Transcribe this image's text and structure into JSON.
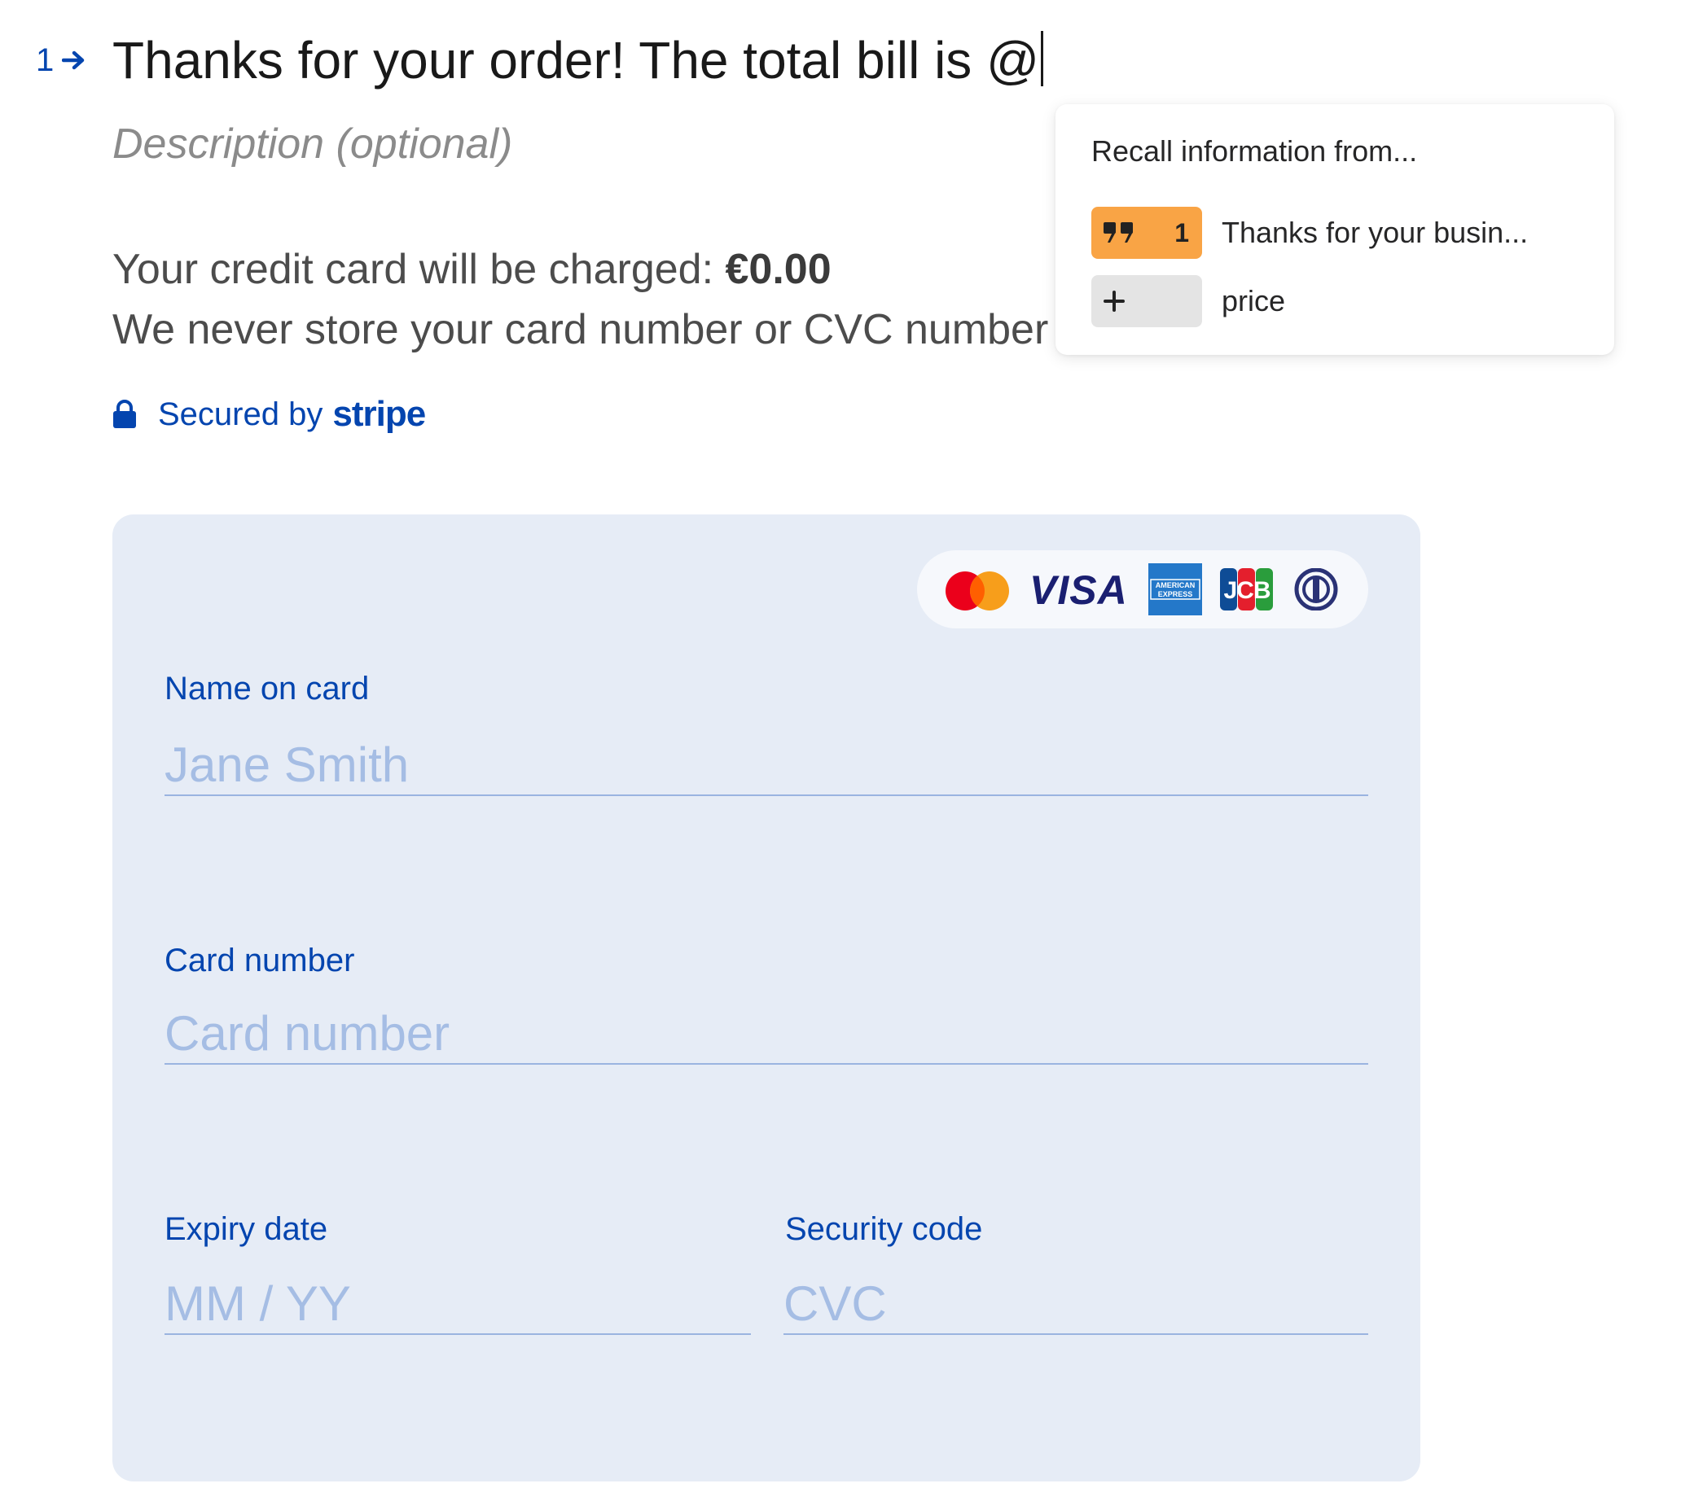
{
  "question": {
    "number": "1",
    "title": "Thanks for your order! The total bill is @",
    "description_placeholder": "Description (optional)"
  },
  "payment": {
    "charge_prefix": "Your credit card will be charged: ",
    "charge_amount": "€0.00",
    "store_notice": "We never store your card number or CVC number",
    "secured_by": "Secured by",
    "stripe_brand": "stripe"
  },
  "card_brands": [
    "mastercard-icon",
    "visa-icon",
    "amex-icon",
    "jcb-icon",
    "diners-icon"
  ],
  "brand_text": {
    "visa": "VISA",
    "amex_line1": "AMERICAN",
    "amex_line2": "EXPRESS",
    "jcb": "JCB"
  },
  "fields": {
    "name": {
      "label": "Name on card",
      "placeholder": "Jane Smith"
    },
    "number": {
      "label": "Card number",
      "placeholder": "Card number"
    },
    "expiry": {
      "label": "Expiry date",
      "placeholder": "MM / YY"
    },
    "cvc": {
      "label": "Security code",
      "placeholder": "CVC"
    }
  },
  "recall_menu": {
    "title": "Recall information from...",
    "items": [
      {
        "icon": "quote-icon",
        "badge": "1",
        "label": "Thanks for your busin...",
        "color": "#f9a445"
      },
      {
        "icon": "plus-icon",
        "badge": "",
        "label": "price",
        "color": "#e4e4e4"
      }
    ]
  },
  "colors": {
    "accent": "#0445af",
    "panel": "#e6ecf6",
    "placeholder": "#a5bde4"
  }
}
